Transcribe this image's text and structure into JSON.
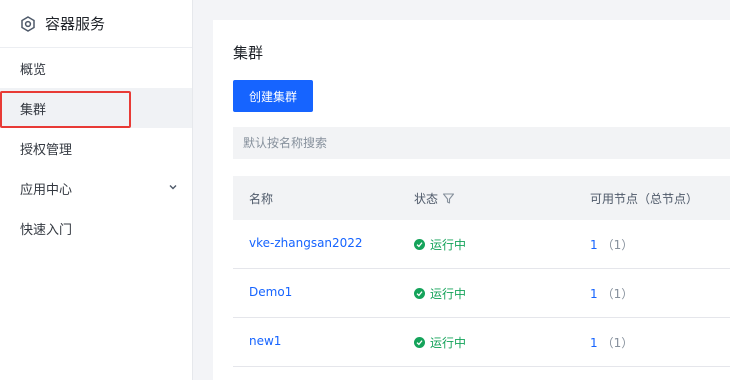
{
  "sidebar": {
    "title": "容器服务",
    "items": [
      {
        "label": "概览"
      },
      {
        "label": "集群"
      },
      {
        "label": "授权管理"
      },
      {
        "label": "应用中心"
      },
      {
        "label": "快速入门"
      }
    ]
  },
  "main": {
    "title": "集群",
    "create_button": "创建集群",
    "search_placeholder": "默认按名称搜索",
    "columns": [
      "名称",
      "状态",
      "可用节点（总节点）"
    ],
    "rows": [
      {
        "name": "vke-zhangsan2022",
        "status": "运行中",
        "available_nodes": "1",
        "total_nodes": "（1）"
      },
      {
        "name": "Demo1",
        "status": "运行中",
        "available_nodes": "1",
        "total_nodes": "（1）"
      },
      {
        "name": "new1",
        "status": "运行中",
        "available_nodes": "1",
        "total_nodes": "（1）"
      }
    ]
  },
  "colors": {
    "accent": "#1664ff",
    "status_running": "#14a35a",
    "annotation": "#e83a35"
  }
}
